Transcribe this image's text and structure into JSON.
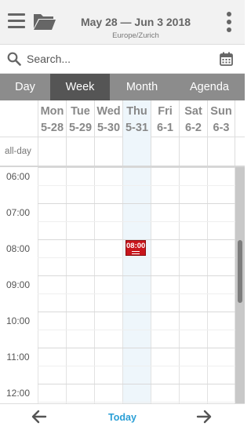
{
  "header": {
    "date_range": "May 28 — Jun 3 2018",
    "timezone": "Europe/Zurich",
    "menu_icon": "hamburger-menu-icon",
    "folder_icon": "folder-open-icon",
    "more_icon": "more-vertical-icon"
  },
  "search": {
    "placeholder": "Search...",
    "value": "",
    "search_icon": "search-icon",
    "calendar_icon": "calendar-icon"
  },
  "tabs": [
    {
      "label": "Day",
      "active": false
    },
    {
      "label": "Week",
      "active": true
    },
    {
      "label": "Month",
      "active": false
    },
    {
      "label": "Agenda",
      "active": false
    }
  ],
  "week": {
    "days": [
      {
        "name": "Mon",
        "date": "5-28",
        "today": false
      },
      {
        "name": "Tue",
        "date": "5-29",
        "today": false
      },
      {
        "name": "Wed",
        "date": "5-30",
        "today": false
      },
      {
        "name": "Thu",
        "date": "5-31",
        "today": true
      },
      {
        "name": "Fri",
        "date": "6-1",
        "today": false
      },
      {
        "name": "Sat",
        "date": "6-2",
        "today": false
      },
      {
        "name": "Sun",
        "date": "6-3",
        "today": false
      }
    ],
    "allday_label": "all-day",
    "hours": [
      "06:00",
      "07:00",
      "08:00",
      "09:00",
      "10:00",
      "11:00",
      "12:00"
    ]
  },
  "events": [
    {
      "time": "08:00",
      "day": "Thu",
      "color": "#c8151b"
    }
  ],
  "bottom_nav": {
    "today_label": "Today",
    "prev_icon": "arrow-left-icon",
    "next_icon": "arrow-right-icon"
  },
  "colors": {
    "accent": "#2a9fd6",
    "active_tab": "#555555",
    "tab_bar": "#8c8c8c",
    "today_column": "#eef6fb",
    "event": "#c8151b"
  }
}
